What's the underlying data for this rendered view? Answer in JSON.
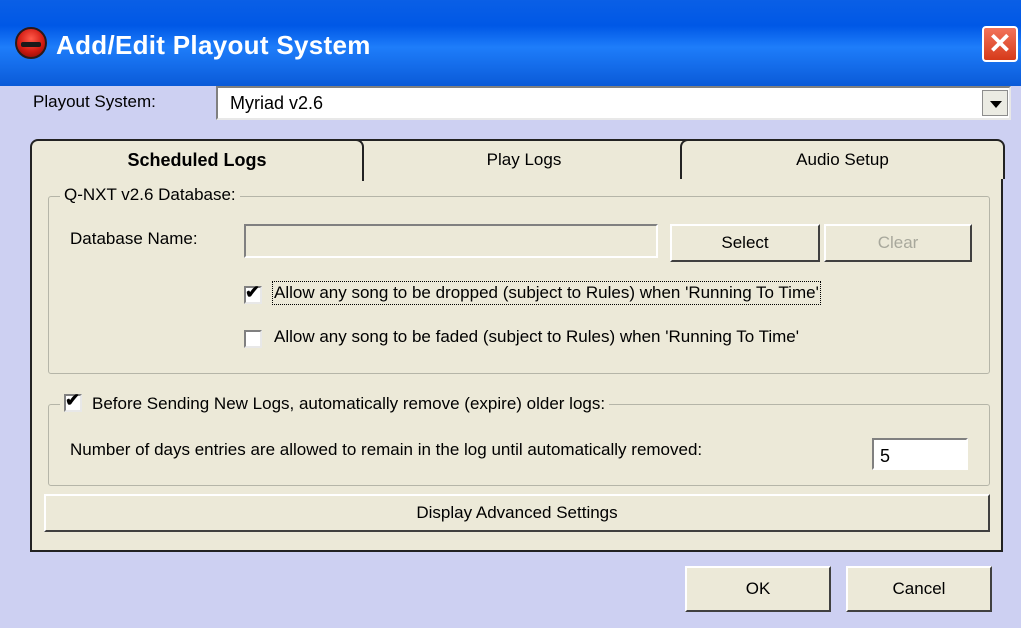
{
  "window": {
    "title": "Add/Edit Playout System",
    "close_symbol": "✕",
    "app_icon": "app-logo-icon"
  },
  "playout_system": {
    "label": "Playout System:",
    "value": "Myriad v2.6"
  },
  "tabs": [
    {
      "label": "Scheduled Logs",
      "active": true
    },
    {
      "label": "Play Logs",
      "active": false
    },
    {
      "label": "Audio Setup",
      "active": false
    }
  ],
  "database_group": {
    "legend": "Q-NXT v2.6 Database:",
    "db_name_label": "Database Name:",
    "db_name_value": "",
    "select_label": "Select",
    "clear_label": "Clear",
    "option_drop": {
      "label": "Allow any song to be dropped (subject to Rules) when 'Running To Time'",
      "checked": true
    },
    "option_fade": {
      "label": "Allow any song to be faded (subject to Rules) when 'Running To Time'",
      "checked": false
    }
  },
  "expire_group": {
    "legend": "Before Sending New Logs, automatically remove (expire) older logs:",
    "checked": true,
    "days_label": "Number of days entries are allowed to remain in the log until automatically removed:",
    "days_value": "5"
  },
  "advanced_label": "Display Advanced Settings",
  "footer": {
    "ok_label": "OK",
    "cancel_label": "Cancel"
  },
  "check_glyph": "✔"
}
